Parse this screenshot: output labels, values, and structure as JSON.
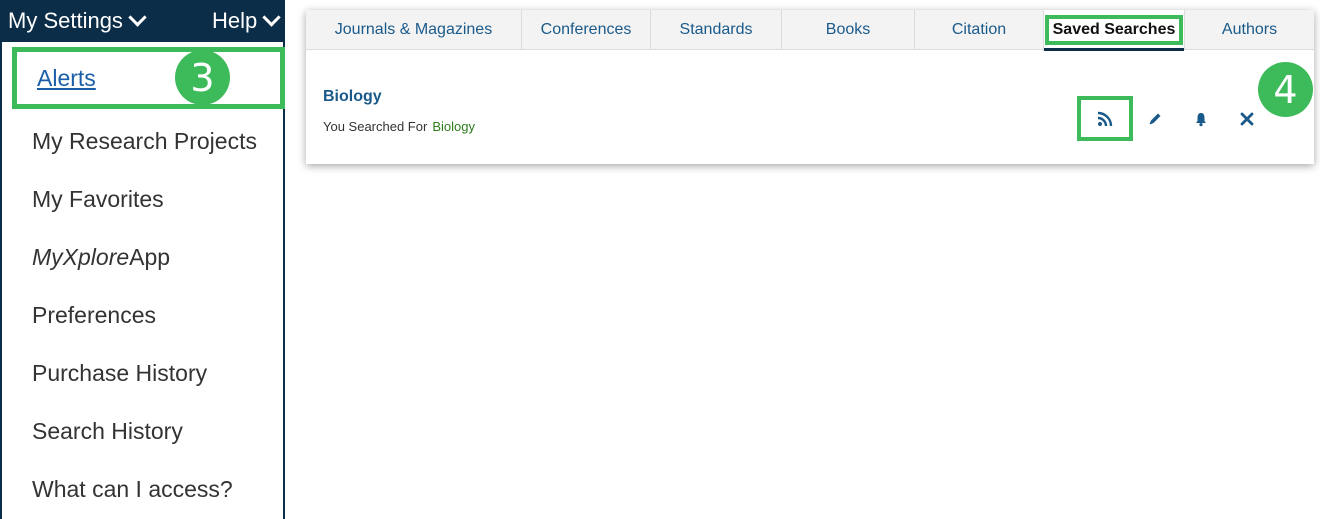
{
  "topbar": {
    "my_settings_label": "My Settings",
    "help_label": "Help"
  },
  "menu": {
    "items": [
      {
        "label": "Alerts"
      },
      {
        "label": "My Research Projects"
      },
      {
        "label": "My Favorites"
      },
      {
        "label_em": "MyXplore",
        "label_rest": "App"
      },
      {
        "label": "Preferences"
      },
      {
        "label": "Purchase History"
      },
      {
        "label": "Search History"
      },
      {
        "label": "What can I access?"
      }
    ]
  },
  "tabs": [
    {
      "label": "Journals & Magazines"
    },
    {
      "label": "Conferences"
    },
    {
      "label": "Standards"
    },
    {
      "label": "Books"
    },
    {
      "label": "Citation"
    },
    {
      "label": "Saved Searches",
      "active": true
    },
    {
      "label": "Authors"
    }
  ],
  "saved_search": {
    "title": "Biology",
    "searched_for_label": "You Searched For",
    "term": "Biology"
  },
  "icons": {
    "rss": "rss-icon",
    "edit": "pencil-icon",
    "alert": "bell-icon",
    "delete": "close-icon"
  },
  "badges": {
    "step3": "3",
    "step4": "4"
  },
  "colors": {
    "navy": "#0c2d48",
    "highlight_green": "#3dbb5a",
    "link_blue": "#1a5a8a",
    "term_green": "#2e7d1c"
  }
}
